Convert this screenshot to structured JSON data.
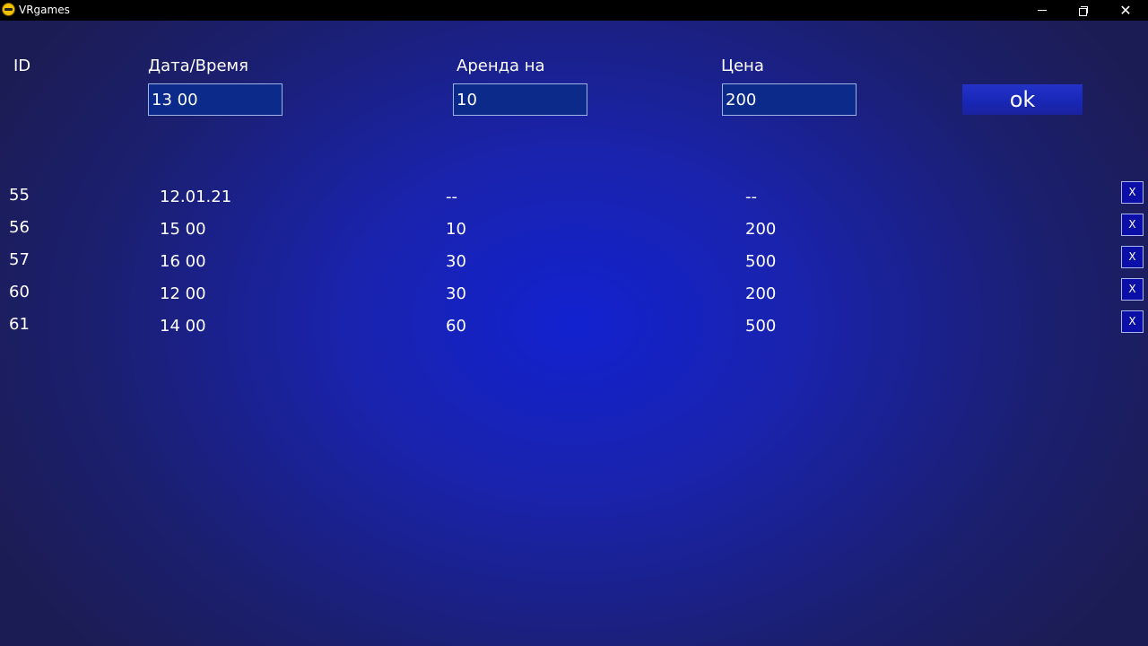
{
  "window": {
    "title": "VRgames",
    "controls": {
      "minimize_icon": "minimize-icon",
      "maximize_icon": "restore-icon",
      "close_icon": "close-icon",
      "close_glyph": "✕"
    }
  },
  "form": {
    "headers": {
      "id": "ID",
      "datetime": "Дата/Время",
      "rent": "Аренда на",
      "price": "Цена"
    },
    "inputs": {
      "datetime": "13 00",
      "rent": "10",
      "price": "200"
    },
    "submit_label": "ok"
  },
  "rows": [
    {
      "id": "55",
      "datetime": "12.01.21",
      "rent": "--",
      "price": "--",
      "delete_label": "X"
    },
    {
      "id": "56",
      "datetime": "15 00",
      "rent": "10",
      "price": "200",
      "delete_label": "X"
    },
    {
      "id": "57",
      "datetime": "16 00",
      "rent": "30",
      "price": "500",
      "delete_label": "X"
    },
    {
      "id": "60",
      "datetime": "12 00",
      "rent": "30",
      "price": "200",
      "delete_label": "X"
    },
    {
      "id": "61",
      "datetime": "14 00",
      "rent": "60",
      "price": "500",
      "delete_label": "X"
    }
  ],
  "colors": {
    "background_center": "#1222cf",
    "background_edge": "#1c1c55",
    "titlebar": "#000000",
    "input_bg": "#0c2a8a",
    "input_border": "#9fb2e6",
    "delete_bg": "#0b0fa8"
  }
}
